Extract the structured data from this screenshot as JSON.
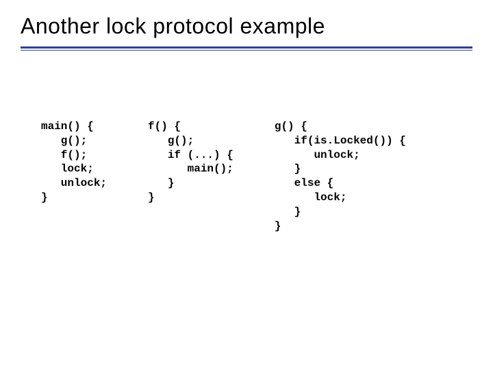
{
  "title": "Another lock protocol example",
  "code": {
    "main": "main() {\n   g();\n   f();\n   lock;\n   unlock;\n}",
    "f": "f() {\n   g();\n   if (...) {\n      main();\n   }\n}",
    "g": "g() {\n   if(is.Locked()) {\n      unlock;\n   }\n   else {\n      lock;\n   }\n}"
  }
}
